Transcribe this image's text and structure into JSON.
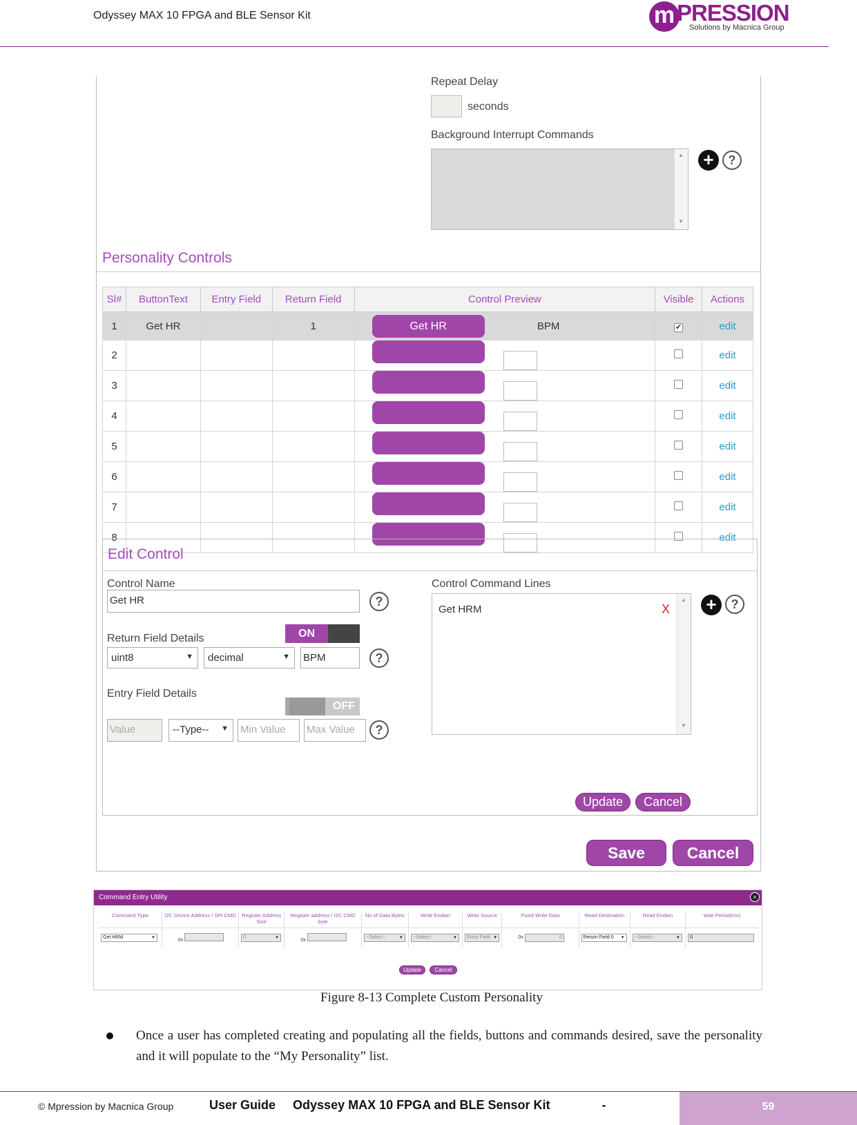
{
  "header": {
    "doc_title": "Odyssey MAX 10 FPGA and BLE Sensor Kit",
    "logo_mark": "m",
    "logo_text": "PRESSION",
    "logo_sub": "Solutions by Macnica Group"
  },
  "figure1": {
    "repeat_delay_label": "Repeat Delay",
    "seconds_label": "seconds",
    "bg_interrupt_label": "Background Interrupt Commands",
    "personality_controls_title": "Personality Controls",
    "table_headers": [
      "Sl#",
      "ButtonText",
      "Entry Field",
      "Return Field",
      "Control Preview",
      "Visible",
      "Actions"
    ],
    "rows": [
      {
        "sl": "1",
        "button_text": "Get HR",
        "entry_field": "",
        "return_field": "1",
        "preview_button": "Get HR",
        "preview_value": "BPM",
        "visible": true,
        "action": "edit"
      },
      {
        "sl": "2",
        "button_text": "",
        "entry_field": "",
        "return_field": "",
        "preview_button": "",
        "preview_value": "",
        "visible": false,
        "action": "edit"
      },
      {
        "sl": "3",
        "button_text": "",
        "entry_field": "",
        "return_field": "",
        "preview_button": "",
        "preview_value": "",
        "visible": false,
        "action": "edit"
      },
      {
        "sl": "4",
        "button_text": "",
        "entry_field": "",
        "return_field": "",
        "preview_button": "",
        "preview_value": "",
        "visible": false,
        "action": "edit"
      },
      {
        "sl": "5",
        "button_text": "",
        "entry_field": "",
        "return_field": "",
        "preview_button": "",
        "preview_value": "",
        "visible": false,
        "action": "edit"
      },
      {
        "sl": "6",
        "button_text": "",
        "entry_field": "",
        "return_field": "",
        "preview_button": "",
        "preview_value": "",
        "visible": false,
        "action": "edit"
      },
      {
        "sl": "7",
        "button_text": "",
        "entry_field": "",
        "return_field": "",
        "preview_button": "",
        "preview_value": "",
        "visible": false,
        "action": "edit"
      },
      {
        "sl": "8",
        "button_text": "",
        "entry_field": "",
        "return_field": "",
        "preview_button": "",
        "preview_value": "",
        "visible": false,
        "action": "edit"
      }
    ],
    "edit_control_title": "Edit Control",
    "control_name_label": "Control Name",
    "control_name_value": "Get HR",
    "return_field_label": "Return Field Details",
    "return_toggle": "ON",
    "return_type": "uint8",
    "return_format": "decimal",
    "return_unit": "BPM",
    "entry_field_label": "Entry Field Details",
    "entry_toggle": "OFF",
    "entry_value_placeholder": "Value",
    "entry_type": "--Type--",
    "entry_min_placeholder": "Min Value",
    "entry_max_placeholder": "Max Value",
    "command_lines_label": "Control Command Lines",
    "command_line_1": "Get HRM",
    "remove_mark": "X",
    "help_glyph": "?",
    "plus_glyph": "+",
    "update_label": "Update",
    "cancel_label": "Cancel",
    "save_label": "Save",
    "cancel_big_label": "Cancel"
  },
  "figure2": {
    "title": "Command Entry Utility",
    "close_glyph": "×",
    "headers": [
      "Command Type",
      "I2C Device Address / SPI CMD",
      "Register Address Size",
      "Register address / I2C CMD byte",
      "No of Data Bytes",
      "Write Endian",
      "Write Source",
      "Fixed Write Data",
      "Read Destination",
      "Read Endian",
      "Wait Period(ms)"
    ],
    "command_type": "Get HRM",
    "hex_prefix": "0x",
    "reg_size": "0",
    "select_placeholder": "--Select--",
    "write_source": "Entry Field",
    "fixed_write_data": "0",
    "read_destination": "Return Field 0",
    "wait_period": "0",
    "update_label": "Update",
    "cancel_label": "Cancel"
  },
  "caption": "Figure 8-13 Complete Custom Personality",
  "bullet_text": "Once a user has completed creating and populating all the fields, buttons and commands desired, save the personality and it will populate to the “My Personality” list.",
  "footer": {
    "copyright": "© Mpression by Macnica Group",
    "guide_text": "User Guide     Odyssey MAX 10 FPGA and BLE Sensor Kit               -",
    "page_number": "59"
  },
  "colors": {
    "brand": "#8e1f8e",
    "accent_button": "#a046a8",
    "link": "#2a9ad0"
  }
}
